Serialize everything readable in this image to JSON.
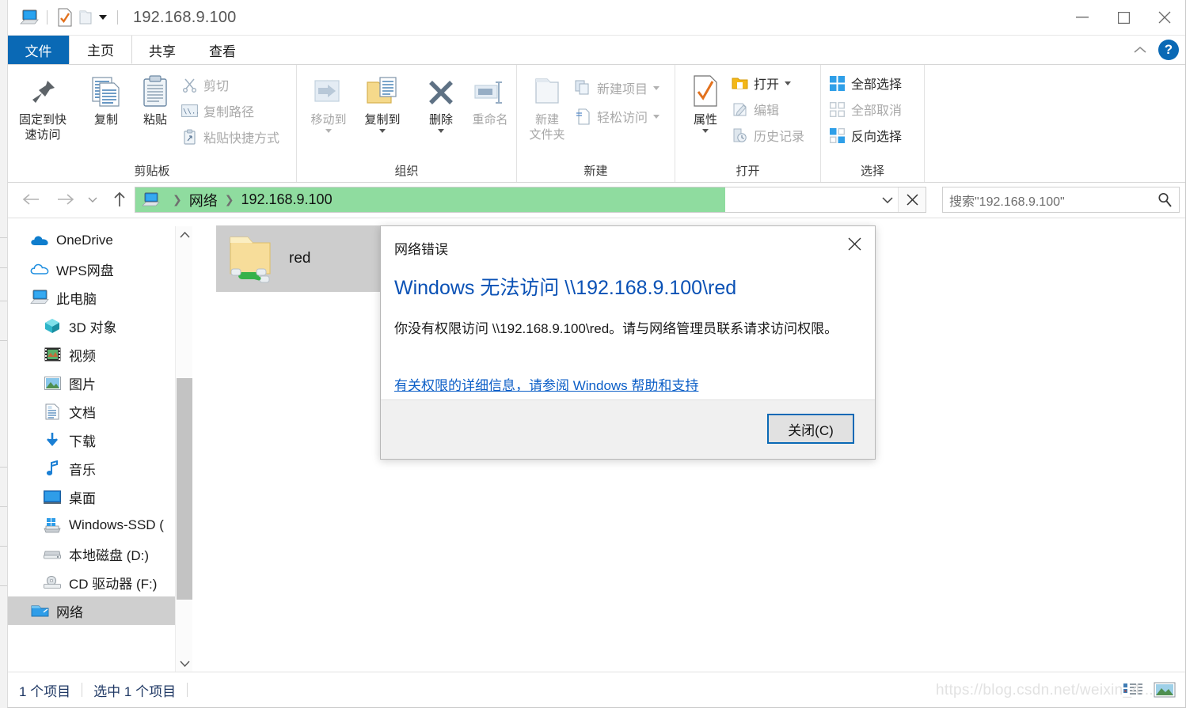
{
  "window": {
    "title": "192.168.9.100",
    "quick_access_icons": [
      "this-pc-icon",
      "properties-check-icon",
      "new-folder-icon",
      "customize-caret-icon"
    ],
    "controls": {
      "minimize": "—",
      "maximize": "□",
      "close": "✕"
    }
  },
  "tabs": [
    {
      "label": "文件",
      "name": "tab-file"
    },
    {
      "label": "主页",
      "name": "tab-home"
    },
    {
      "label": "共享",
      "name": "tab-share"
    },
    {
      "label": "查看",
      "name": "tab-view"
    }
  ],
  "ribbon": {
    "collapse_icon": "chevron-up-icon",
    "help_label": "?",
    "groups": [
      {
        "label": "剪贴板",
        "big": [
          {
            "label": "固定到快\n速访问",
            "label_line1": "固定到快",
            "label_line2": "速访问",
            "icon": "pin-icon",
            "disabled": false
          },
          {
            "label": "复制",
            "icon": "copy-icon",
            "disabled": false
          },
          {
            "label": "粘贴",
            "icon": "paste-icon",
            "disabled": false
          }
        ],
        "small": [
          {
            "label": "剪切",
            "icon": "scissors-icon",
            "disabled": true
          },
          {
            "label": "复制路径",
            "icon": "copy-path-icon",
            "disabled": true
          },
          {
            "label": "粘贴快捷方式",
            "icon": "paste-shortcut-icon",
            "disabled": true
          }
        ]
      },
      {
        "label": "组织",
        "big": [
          {
            "label": "移动到",
            "icon": "move-to-icon",
            "disabled": true,
            "has_caret": true
          },
          {
            "label": "复制到",
            "icon": "copy-to-icon",
            "disabled": false,
            "has_caret": true
          },
          {
            "label": "删除",
            "icon": "delete-x-icon",
            "disabled": false,
            "has_caret": true
          },
          {
            "label": "重命名",
            "icon": "rename-icon",
            "disabled": true
          }
        ],
        "small": []
      },
      {
        "label": "新建",
        "big": [
          {
            "label_line1": "新建",
            "label_line2": "文件夹",
            "label": "新建文件夹",
            "icon": "new-folder-icon",
            "disabled": true
          }
        ],
        "small": [
          {
            "label": "新建项目",
            "icon": "new-item-icon",
            "disabled": true,
            "has_caret": true
          },
          {
            "label": "轻松访问",
            "icon": "easy-access-icon",
            "disabled": true,
            "has_caret": true
          }
        ]
      },
      {
        "label": "打开",
        "big": [
          {
            "label": "属性",
            "icon": "properties-icon",
            "disabled": false,
            "has_caret": true
          }
        ],
        "small": [
          {
            "label": "打开",
            "icon": "open-folder-icon",
            "disabled": false,
            "has_caret": true
          },
          {
            "label": "编辑",
            "icon": "edit-icon",
            "disabled": true
          },
          {
            "label": "历史记录",
            "icon": "history-icon",
            "disabled": true
          }
        ]
      },
      {
        "label": "选择",
        "big": [],
        "small": [
          {
            "label": "全部选择",
            "icon": "select-all-icon",
            "disabled": false
          },
          {
            "label": "全部取消",
            "icon": "select-none-icon",
            "disabled": true
          },
          {
            "label": "反向选择",
            "icon": "invert-selection-icon",
            "disabled": false
          }
        ]
      }
    ]
  },
  "address": {
    "back_icon": "arrow-left-icon",
    "forward_icon": "arrow-right-icon",
    "recent_icon": "chevron-down-icon",
    "up_icon": "arrow-up-icon",
    "crumb_icon": "network-computer-icon",
    "crumbs": [
      "网络",
      "192.168.9.100"
    ],
    "highlight_color": "#8fdc9f",
    "dropdown_icon": "chevron-down-icon",
    "stop_icon": "close-x-icon"
  },
  "search": {
    "placeholder": "搜索\"192.168.9.100\"",
    "icon": "search-icon"
  },
  "sidebar": {
    "items": [
      {
        "label": "OneDrive",
        "icon": "onedrive-icon",
        "indent": 26,
        "selected": false
      },
      {
        "label": "WPS网盘",
        "icon": "wps-cloud-icon",
        "indent": 26,
        "selected": false
      },
      {
        "label": "此电脑",
        "icon": "this-pc-icon",
        "indent": 26,
        "selected": false
      },
      {
        "label": "3D 对象",
        "icon": "3d-objects-icon",
        "indent": 42,
        "selected": false
      },
      {
        "label": "视频",
        "icon": "videos-icon",
        "indent": 42,
        "selected": false
      },
      {
        "label": "图片",
        "icon": "pictures-icon",
        "indent": 42,
        "selected": false
      },
      {
        "label": "文档",
        "icon": "documents-icon",
        "indent": 42,
        "selected": false
      },
      {
        "label": "下载",
        "icon": "downloads-icon",
        "indent": 42,
        "selected": false
      },
      {
        "label": "音乐",
        "icon": "music-icon",
        "indent": 42,
        "selected": false
      },
      {
        "label": "桌面",
        "icon": "desktop-icon",
        "indent": 42,
        "selected": false
      },
      {
        "label": "Windows-SSD (",
        "icon": "windows-drive-icon",
        "indent": 42,
        "selected": false
      },
      {
        "label": "本地磁盘 (D:)",
        "icon": "local-disk-icon",
        "indent": 42,
        "selected": false
      },
      {
        "label": "CD 驱动器 (F:)",
        "icon": "cd-drive-icon",
        "indent": 42,
        "selected": false
      },
      {
        "label": "网络",
        "icon": "network-icon",
        "indent": 26,
        "selected": true
      }
    ],
    "scroll_up_icon": "chevron-up-icon",
    "scroll_down_icon": "chevron-down-icon"
  },
  "content": {
    "items": [
      {
        "name": "red",
        "icon": "network-shared-folder-icon",
        "selected": true
      }
    ]
  },
  "status": {
    "item_count": "1 个项目",
    "selection": "选中 1 个项目",
    "view_details_icon": "details-view-icon",
    "view_icons_icon": "large-icons-view-icon"
  },
  "watermark": "https://blog.csdn.net/weixin_4...",
  "dialog": {
    "title": "网络错误",
    "close_icon": "close-x-icon",
    "heading": "Windows 无法访问 \\\\192.168.9.100\\red",
    "body": "你没有权限访问 \\\\192.168.9.100\\red。请与网络管理员联系请求访问权限。",
    "link": "有关权限的详细信息，请参阅 Windows 帮助和支持",
    "button": "关闭(C)"
  }
}
